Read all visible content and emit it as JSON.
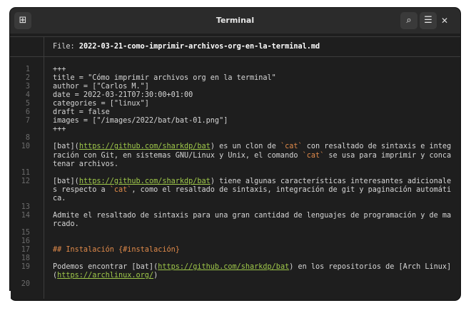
{
  "window": {
    "title": "Terminal",
    "buttons": {
      "new_tab": "⊞",
      "search": "⌕",
      "menu": "☰",
      "close": "✕"
    }
  },
  "file": {
    "label": "File:",
    "name": "2022-03-21-como-imprimir-archivos-org-en-la-terminal.md"
  },
  "lines": [
    {
      "n": "1",
      "segments": [
        {
          "t": "+++"
        }
      ]
    },
    {
      "n": "2",
      "segments": [
        {
          "t": "title = \"Cómo imprimir archivos org en la terminal\""
        }
      ]
    },
    {
      "n": "3",
      "segments": [
        {
          "t": "author = [\"Carlos M.\"]"
        }
      ]
    },
    {
      "n": "4",
      "segments": [
        {
          "t": "date = 2022-03-21T07:30:00+01:00"
        }
      ]
    },
    {
      "n": "5",
      "segments": [
        {
          "t": "categories = [\"linux\"]"
        }
      ]
    },
    {
      "n": "6",
      "segments": [
        {
          "t": "draft = false"
        }
      ]
    },
    {
      "n": "7",
      "segments": [
        {
          "t": "images = [\"/images/2022/bat/bat-01.png\"]"
        }
      ]
    },
    {
      "n": "",
      "segments": [
        {
          "t": "+++"
        }
      ]
    },
    {
      "n": "8",
      "segments": []
    },
    {
      "n": "10",
      "segments": [
        {
          "t": "[bat]("
        },
        {
          "t": "https://github.com/sharkdp/bat",
          "c": "link"
        },
        {
          "t": ") es un clon de "
        },
        {
          "t": "`cat`",
          "c": "code"
        },
        {
          "t": " con resaltado de sintaxis e integ"
        }
      ]
    },
    {
      "n": "",
      "segments": [
        {
          "t": "ración con Git, en sistemas GNU/Linux y Unix, el comando "
        },
        {
          "t": "`cat`",
          "c": "code"
        },
        {
          "t": " se usa para imprimir y conca"
        }
      ]
    },
    {
      "n": "",
      "segments": [
        {
          "t": "tenar archivos."
        }
      ]
    },
    {
      "n": "11",
      "segments": []
    },
    {
      "n": "12",
      "segments": [
        {
          "t": "[bat]("
        },
        {
          "t": "https://github.com/sharkdp/bat",
          "c": "link"
        },
        {
          "t": ") tiene algunas características interesantes adicionale"
        }
      ]
    },
    {
      "n": "",
      "segments": [
        {
          "t": "s respecto a "
        },
        {
          "t": "`cat`",
          "c": "code"
        },
        {
          "t": ", como el resaltado de sintaxis, integración de git y paginación automáti"
        }
      ]
    },
    {
      "n": "",
      "segments": [
        {
          "t": "ca."
        }
      ]
    },
    {
      "n": "13",
      "segments": []
    },
    {
      "n": "14",
      "segments": [
        {
          "t": "Admite el resaltado de sintaxis para una gran cantidad de lenguajes de programación y de ma"
        }
      ]
    },
    {
      "n": "",
      "segments": [
        {
          "t": "rcado."
        }
      ]
    },
    {
      "n": "15",
      "segments": []
    },
    {
      "n": "16",
      "segments": []
    },
    {
      "n": "17",
      "segments": [
        {
          "t": "## Instalación {#instalación}",
          "c": "head"
        }
      ]
    },
    {
      "n": "18",
      "segments": []
    },
    {
      "n": "19",
      "segments": [
        {
          "t": "Podemos encontrar [bat]("
        },
        {
          "t": "https://github.com/sharkdp/bat",
          "c": "link"
        },
        {
          "t": ") en los repositorios de [Arch Linux]"
        }
      ]
    },
    {
      "n": "",
      "segments": [
        {
          "t": "("
        },
        {
          "t": "https://archlinux.org/",
          "c": "link"
        },
        {
          "t": ")"
        }
      ]
    },
    {
      "n": "20",
      "segments": []
    }
  ],
  "prompt": ":"
}
